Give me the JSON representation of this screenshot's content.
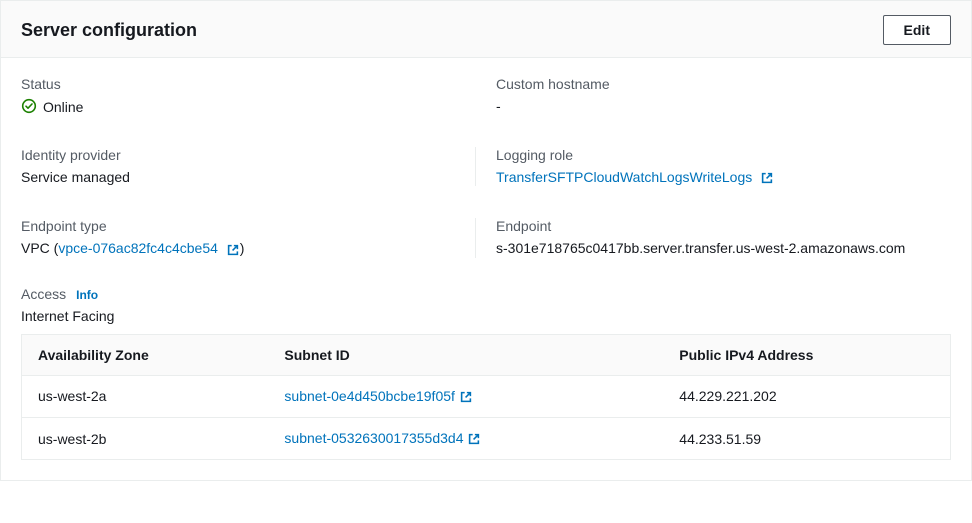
{
  "panel": {
    "title": "Server configuration",
    "edit_label": "Edit"
  },
  "fields": {
    "status": {
      "label": "Status",
      "value": "Online"
    },
    "custom_hostname": {
      "label": "Custom hostname",
      "value": "-"
    },
    "identity_provider": {
      "label": "Identity provider",
      "value": "Service managed"
    },
    "logging_role": {
      "label": "Logging role",
      "link_text": "TransferSFTPCloudWatchLogsWriteLogs"
    },
    "endpoint_type": {
      "label": "Endpoint type",
      "prefix": "VPC (",
      "link_text": "vpce-076ac82fc4c4cbe54",
      "suffix": ")"
    },
    "endpoint": {
      "label": "Endpoint",
      "value": "s-301e718765c0417bb.server.transfer.us-west-2.amazonaws.com"
    }
  },
  "access": {
    "label": "Access",
    "info": "Info",
    "value": "Internet Facing",
    "columns": {
      "az": "Availability Zone",
      "subnet": "Subnet ID",
      "ip": "Public IPv4 Address"
    },
    "rows": [
      {
        "az": "us-west-2a",
        "subnet": "subnet-0e4d450bcbe19f05f",
        "ip": "44.229.221.202"
      },
      {
        "az": "us-west-2b",
        "subnet": "subnet-0532630017355d3d4",
        "ip": "44.233.51.59"
      }
    ]
  }
}
